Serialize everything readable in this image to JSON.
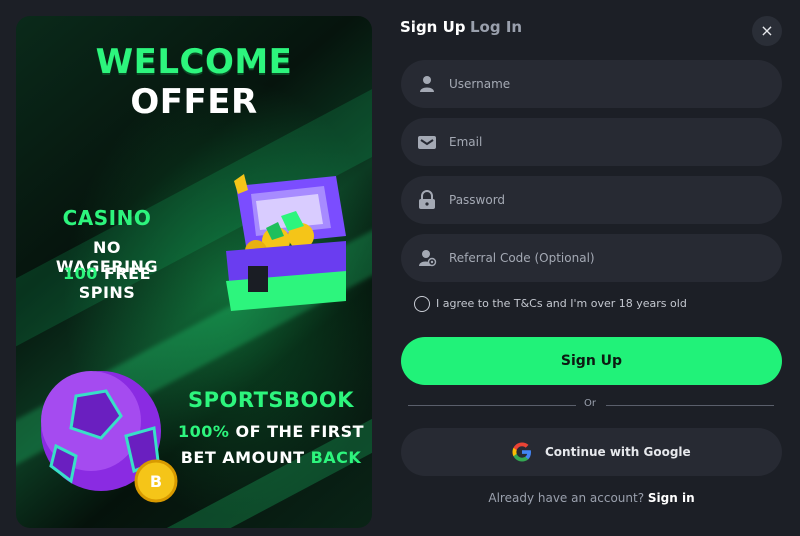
{
  "promo": {
    "welcome_line1": "WELCOME",
    "welcome_line2": "OFFER",
    "casino_title": "CASINO",
    "casino_line1": "NO WAGERING",
    "casino_spins_number": "100",
    "casino_spins_text": " FREE SPINS",
    "sportsbook_title": "SPORTSBOOK",
    "sportsbook_percent": "100%",
    "sportsbook_line1_rest": " OF THE FIRST",
    "sportsbook_line2_start": "BET AMOUNT ",
    "sportsbook_line2_end": "BACK"
  },
  "tabs": {
    "signup": "Sign Up",
    "login": "Log In"
  },
  "close_icon": "×",
  "fields": {
    "username_placeholder": "Username",
    "email_placeholder": "Email",
    "password_placeholder": "Password",
    "referral_placeholder": "Referral Code (Optional)"
  },
  "agree_text": "I agree to the T&Cs and I'm over 18 years old",
  "signup_button": "Sign Up",
  "divider_text": "Or",
  "google_button": "Continue with Google",
  "footer": {
    "prompt": "Already have an account? ",
    "link": "Sign in"
  },
  "colors": {
    "accent": "#21f279",
    "field_bg": "#272a33",
    "panel_bg": "#1c1f26"
  },
  "icons": [
    "user-icon",
    "email-icon",
    "lock-icon",
    "referral-user-icon",
    "google-icon",
    "close-icon"
  ]
}
